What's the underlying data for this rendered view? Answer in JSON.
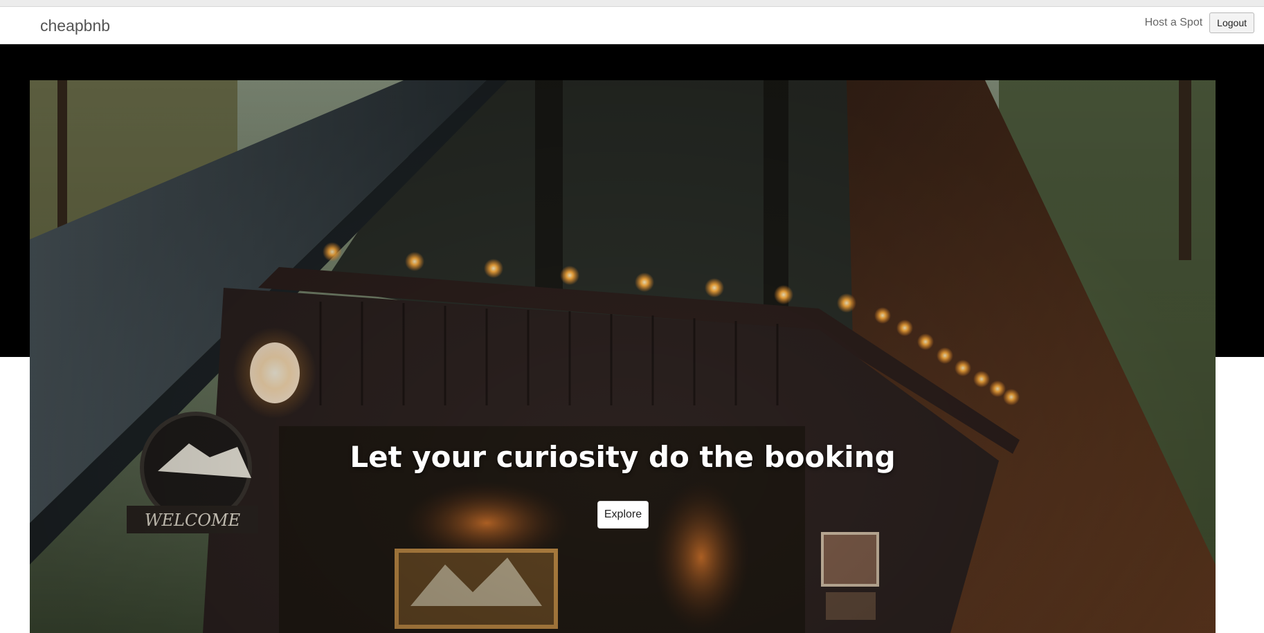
{
  "navbar": {
    "brand": "cheapbnb",
    "host_link": "Host a Spot",
    "logout_label": "Logout"
  },
  "hero": {
    "title": "Let your curiosity do the booking",
    "explore_label": "Explore",
    "image_description_icon": "a-frame-cabin-photo"
  },
  "colors": {
    "page_bg": "#ffffff",
    "band_bg": "#000000",
    "button_bg": "#ffffff"
  }
}
